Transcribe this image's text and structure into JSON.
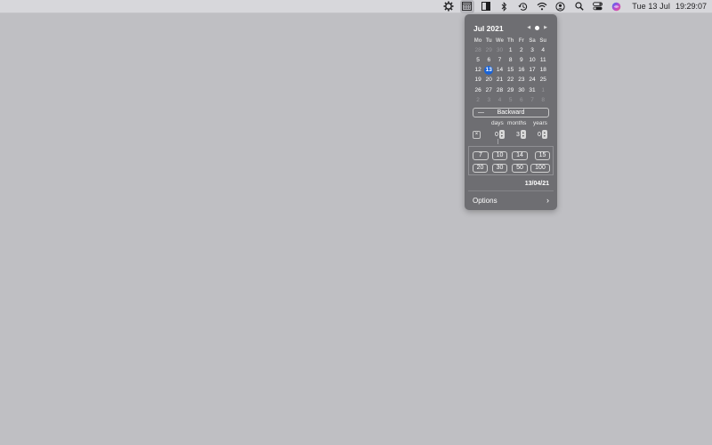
{
  "menubar": {
    "icons": [
      "gear-badge-icon",
      "calendar-icon",
      "split-square-icon",
      "bluetooth-icon",
      "time-machine-icon",
      "wifi-icon",
      "user-circle-icon",
      "search-icon",
      "control-center-icon",
      "siri-icon"
    ],
    "date": "Tue 13 Jul",
    "time": "19:29:07"
  },
  "calendar": {
    "month_label": "Jul 2021",
    "prev": "◀",
    "next": "▶",
    "weekdays": [
      "Mo",
      "Tu",
      "We",
      "Th",
      "Fr",
      "Sa",
      "Su"
    ],
    "weeks": [
      [
        "28",
        "29",
        "30",
        "1",
        "2",
        "3",
        "4"
      ],
      [
        "5",
        "6",
        "7",
        "8",
        "9",
        "10",
        "11"
      ],
      [
        "12",
        "13",
        "14",
        "15",
        "16",
        "17",
        "18"
      ],
      [
        "19",
        "20",
        "21",
        "22",
        "23",
        "24",
        "25"
      ],
      [
        "26",
        "27",
        "28",
        "29",
        "30",
        "31",
        "1"
      ],
      [
        "2",
        "3",
        "4",
        "5",
        "6",
        "7",
        "8"
      ]
    ],
    "dim": [
      [
        0,
        0
      ],
      [
        0,
        1
      ],
      [
        0,
        2
      ],
      [
        4,
        6
      ],
      [
        5,
        0
      ],
      [
        5,
        1
      ],
      [
        5,
        2
      ],
      [
        5,
        3
      ],
      [
        5,
        4
      ],
      [
        5,
        5
      ],
      [
        5,
        6
      ]
    ],
    "today": [
      2,
      1
    ]
  },
  "calculator": {
    "direction_label": "Backward",
    "direction_sign": "—",
    "clear_label": "×",
    "units": [
      "days",
      "months",
      "years"
    ],
    "values": {
      "days": "0",
      "months": "3",
      "years": "0"
    },
    "quick_values": [
      "7",
      "10",
      "14",
      "15",
      "20",
      "30",
      "50",
      "100"
    ],
    "result": "13/04/21"
  },
  "footer": {
    "options_label": "Options",
    "chevron": "›"
  },
  "colors": {
    "accent": "#1a63d6",
    "popover_bg": "#6e6e72",
    "desktop_bg": "#bfbfc3"
  }
}
